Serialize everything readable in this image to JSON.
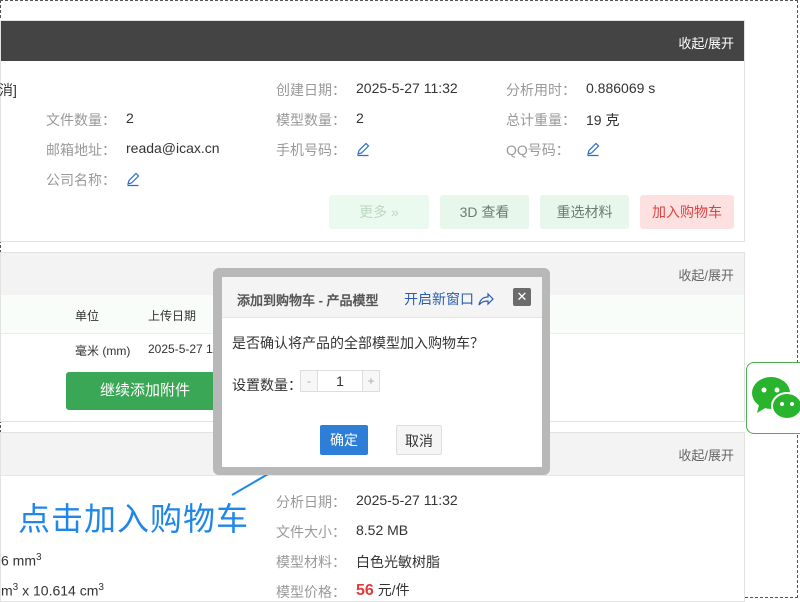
{
  "panel1": {
    "toggle": "收起/展开",
    "bracket": "消]",
    "fields": {
      "create_date_label": "创建日期：",
      "create_date": "2025-5-27 11:32",
      "analysis_time_label": "分析用时：",
      "analysis_time": "0.886069 s",
      "file_count_label": "文件数量：",
      "file_count": "2",
      "model_count_label": "模型数量：",
      "model_count": "2",
      "total_weight_label": "总计重量：",
      "total_weight": "19 克",
      "email_label": "邮箱地址：",
      "email": "reada@icax.cn",
      "phone_label": "手机号码：",
      "qq_label": "QQ号码：",
      "company_label": "公司名称："
    },
    "buttons": {
      "more": "更多 »",
      "view3d": "3D 查看",
      "reselect": "重选材料",
      "add_cart": "加入购物车"
    }
  },
  "panel2": {
    "toggle": "收起/展开",
    "col_unit": "单位",
    "col_upload": "上传日期",
    "row_unit": "毫米 (mm)",
    "row_date": "2025-5-27 11",
    "add_attach": "继续添加附件"
  },
  "panel3": {
    "toggle": "收起/展开",
    "analysis_date_label": "分析日期：",
    "analysis_date": "2025-5-27 11:32",
    "file_size_label": "文件大小：",
    "file_size": "8.52 MB",
    "material_label": "模型材料：",
    "material": "白色光敏树脂",
    "price_label": "模型价格：",
    "price": "56",
    "price_unit": "元/件",
    "vol_fragment": "6 mm",
    "dim_fragment": "m",
    "dim_fragment2": " x 10.614 cm"
  },
  "dialog": {
    "title": "添加到购物车 - 产品模型",
    "open_new": "开启新窗口",
    "question": "是否确认将产品的全部模型加入购物车？",
    "qty_label": "设置数量：",
    "qty": "1",
    "ok": "确定",
    "cancel": "取消"
  },
  "annotation": "点击加入购物车",
  "colors": {
    "accent_blue": "#2d7ed6",
    "cart_red": "#d44",
    "green": "#3aa757",
    "annotation_blue": "#1f87e8"
  }
}
